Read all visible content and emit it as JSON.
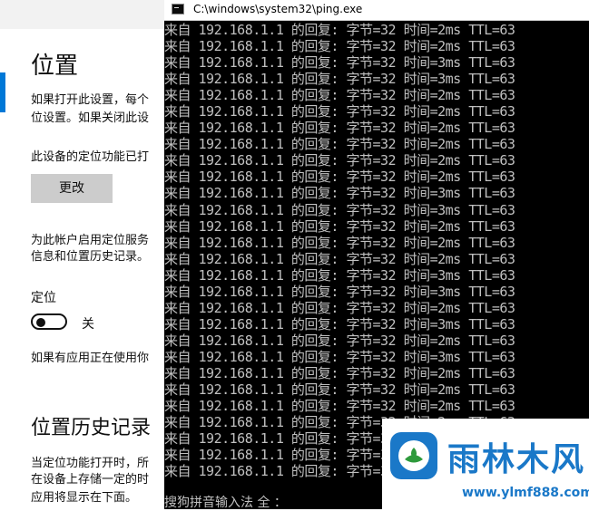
{
  "settings": {
    "title": "位置",
    "desc_line1": "如果打开此设置，每个",
    "desc_line2": "位设置。如果关闭此设",
    "status": "此设备的定位功能已打",
    "change_button": "更改",
    "account_line1": "为此帐户启用定位服务",
    "account_line2": "信息和位置历史记录。",
    "location_label": "定位",
    "toggle_state": "关",
    "apps_text": "如果有应用正在使用你",
    "history_title": "位置历史记录",
    "history_line1": "当定位功能打开时，所",
    "history_line2": "在设备上存储一定的时",
    "history_line3": "应用将显示在下面。"
  },
  "console": {
    "title": "C:\\windows\\system32\\ping.exe",
    "lines": [
      "来自 192.168.1.1 的回复: 字节=32 时间=2ms TTL=63",
      "来自 192.168.1.1 的回复: 字节=32 时间=2ms TTL=63",
      "来自 192.168.1.1 的回复: 字节=32 时间=3ms TTL=63",
      "来自 192.168.1.1 的回复: 字节=32 时间=3ms TTL=63",
      "来自 192.168.1.1 的回复: 字节=32 时间=2ms TTL=63",
      "来自 192.168.1.1 的回复: 字节=32 时间=2ms TTL=63",
      "来自 192.168.1.1 的回复: 字节=32 时间=2ms TTL=63",
      "来自 192.168.1.1 的回复: 字节=32 时间=2ms TTL=63",
      "来自 192.168.1.1 的回复: 字节=32 时间=2ms TTL=63",
      "来自 192.168.1.1 的回复: 字节=32 时间=2ms TTL=63",
      "来自 192.168.1.1 的回复: 字节=32 时间=3ms TTL=63",
      "来自 192.168.1.1 的回复: 字节=32 时间=3ms TTL=63",
      "来自 192.168.1.1 的回复: 字节=32 时间=2ms TTL=63",
      "来自 192.168.1.1 的回复: 字节=32 时间=2ms TTL=63",
      "来自 192.168.1.1 的回复: 字节=32 时间=2ms TTL=63",
      "来自 192.168.1.1 的回复: 字节=32 时间=3ms TTL=63",
      "来自 192.168.1.1 的回复: 字节=32 时间=3ms TTL=63",
      "来自 192.168.1.1 的回复: 字节=32 时间=2ms TTL=63",
      "来自 192.168.1.1 的回复: 字节=32 时间=3ms TTL=63",
      "来自 192.168.1.1 的回复: 字节=32 时间=2ms TTL=63",
      "来自 192.168.1.1 的回复: 字节=32 时间=3ms TTL=63",
      "来自 192.168.1.1 的回复: 字节=32 时间=2ms TTL=63",
      "来自 192.168.1.1 的回复: 字节=32 时间=2ms TTL=63",
      "来自 192.168.1.1 的回复: 字节=32 时间=2ms TTL=63",
      "来自 192.168.1.1 的回复: 字节=32 时间=2ms TTL=63",
      "来自 192.168.1.1 的回复: 字节=32 时间=2ms TTL=63",
      "来自 192.168.1.1 的回复: 字节=32 时间=2ms TTL=63",
      "来自 192.168.1.1 的回复: 字节=32 时间=2ms TTL=63"
    ],
    "ime_status": "搜狗拼音输入法 全 ："
  },
  "watermark": {
    "brand": "雨林木风",
    "url": "www.ylmf888.com"
  },
  "colors": {
    "accent": "#0078d7",
    "console_bg": "#000000",
    "console_text": "#c0c0c0",
    "watermark": "#1a78c8"
  }
}
